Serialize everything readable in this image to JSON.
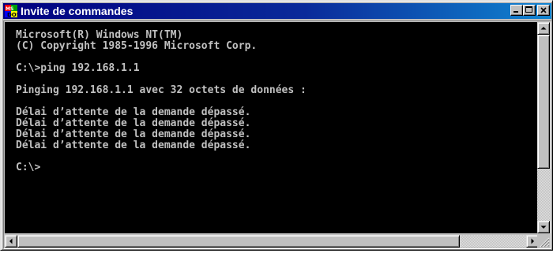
{
  "window": {
    "title": "Invite de commandes",
    "icon": "msdos-icon"
  },
  "title_buttons": {
    "minimize": "minimize-icon",
    "maximize": "maximize-icon",
    "close": "close-icon"
  },
  "console": {
    "lines": [
      "Microsoft(R) Windows NT(TM)",
      "(C) Copyright 1985-1996 Microsoft Corp.",
      "",
      "C:\\>ping 192.168.1.1",
      "",
      "Pinging 192.168.1.1 avec 32 octets de données :",
      "",
      "Délai d’attente de la demande dépassé.",
      "Délai d’attente de la demande dépassé.",
      "Délai d’attente de la demande dépassé.",
      "Délai d’attente de la demande dépassé.",
      "",
      "C:\\>"
    ]
  },
  "colors": {
    "title_bar_start": "#000080",
    "title_bar_end": "#1084d0",
    "console_background": "#000000",
    "console_text": "#c0c0c0",
    "chrome": "#c0c0c0"
  }
}
